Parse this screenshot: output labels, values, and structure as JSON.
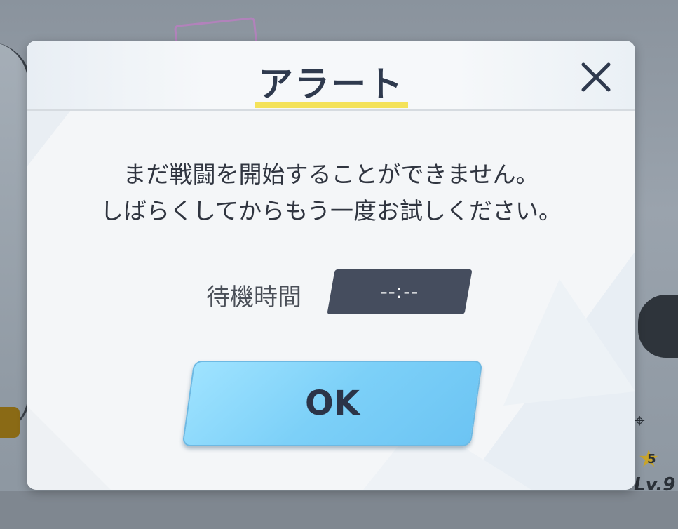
{
  "dialog": {
    "title": "アラート",
    "message_line1": "まだ戦闘を開始することができません。",
    "message_line2": "しばらくしてからもう一度お試しください。",
    "wait_label": "待機時間",
    "wait_value": "--:--",
    "ok_label": "OK",
    "close_icon": "close-icon",
    "colors": {
      "title": "#2f3a4e",
      "underline": "#f4e25a",
      "wait_box": "#454d5e",
      "ok_button": "#7cd0f8"
    }
  },
  "background": {
    "star_rank": "5",
    "level_text": "Lv.9"
  }
}
